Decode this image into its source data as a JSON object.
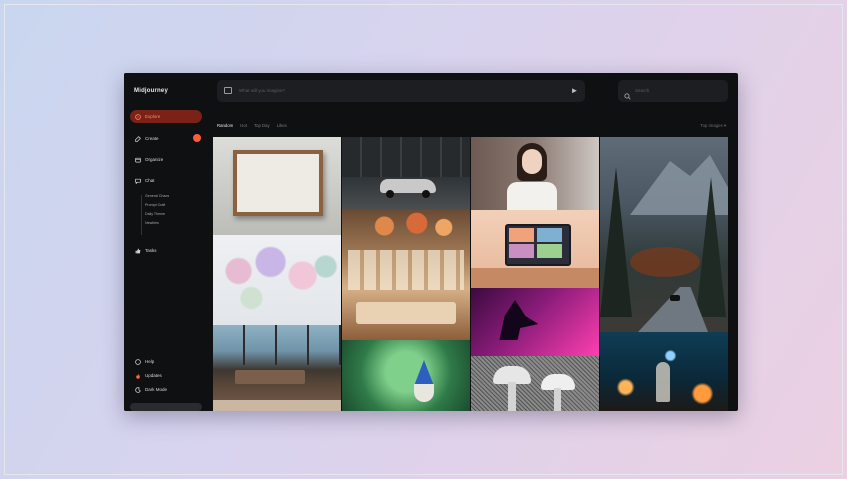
{
  "app": {
    "brand": "Midjourney"
  },
  "sidebar": {
    "items": [
      {
        "label": "Explore",
        "icon": "compass-icon",
        "active": true
      },
      {
        "label": "Create",
        "icon": "brush-icon",
        "badge": true
      },
      {
        "label": "Organize",
        "icon": "folder-icon"
      },
      {
        "label": "Chat",
        "icon": "chat-icon"
      },
      {
        "label": "Tasks",
        "icon": "thumbs-up-icon"
      }
    ],
    "chat_rooms": [
      "General Chaos",
      "Prompt Craft",
      "Daily Theme",
      "Newbies"
    ],
    "bottom": [
      {
        "label": "Help",
        "icon": "help-icon"
      },
      {
        "label": "Updates",
        "icon": "flame-icon"
      },
      {
        "label": "Dark Mode",
        "icon": "moon-icon"
      }
    ]
  },
  "prompt": {
    "placeholder": "What will you imagine?"
  },
  "search": {
    "placeholder": "Search"
  },
  "tabs": [
    "Random",
    "Hot",
    "Top Day",
    "Likes"
  ],
  "sort_label": "Top Images",
  "colors": {
    "accent": "#ff5b3a",
    "active_bg": "#7a2218",
    "background": "#0f1012"
  }
}
